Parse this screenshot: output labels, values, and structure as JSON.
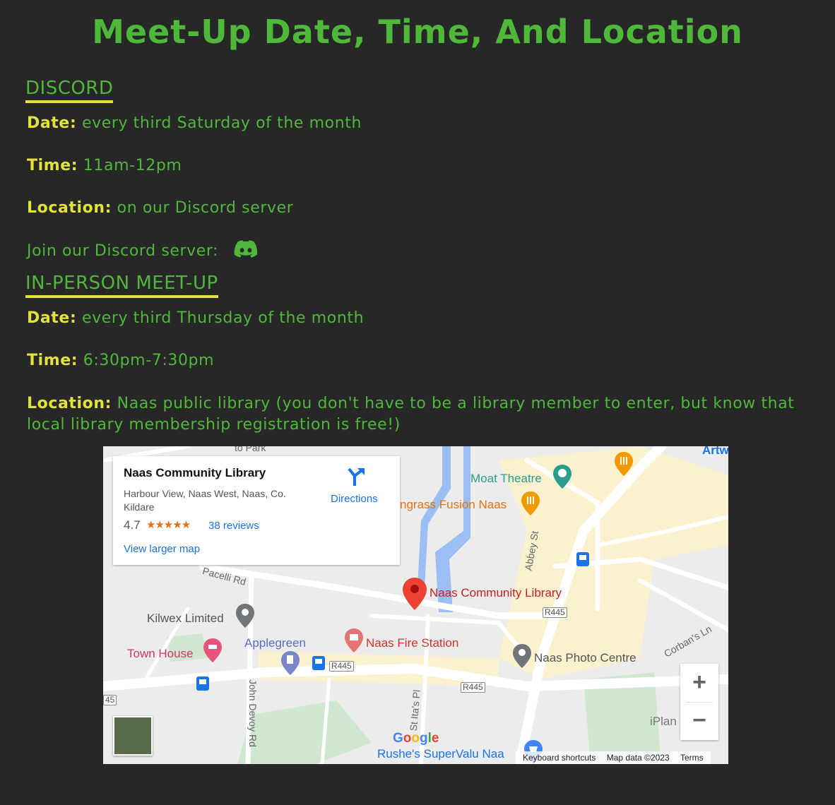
{
  "title": "Meet-Up Date, Time, And Location",
  "discord": {
    "heading": "DISCORD",
    "date_label": "Date:",
    "date_value": "every third Saturday of the month",
    "time_label": "Time:",
    "time_value": "11am-12pm",
    "location_label": "Location:",
    "location_value": "on our Discord server",
    "join_text": "Join our Discord server:",
    "join_icon": "discord-icon"
  },
  "inperson": {
    "heading": "IN-PERSON MEET-UP",
    "date_label": "Date:",
    "date_value": "every third Thursday of the month",
    "time_label": "Time:",
    "time_value": "6:30pm-7:30pm",
    "location_label": "Location:",
    "location_value": "Naas public library (you don't have to be a library member to enter, but know that local library membership registration is free!)"
  },
  "map": {
    "card": {
      "name": "Naas Community Library",
      "address": "Harbour View, Naas West, Naas, Co. Kildare",
      "rating": "4.7",
      "stars": "★★★★★",
      "reviews": "38 reviews",
      "larger_map": "View larger map",
      "directions": "Directions"
    },
    "places": {
      "moat_theatre": "Moat Theatre",
      "lemongrass": "ngrass Fusion Naas",
      "library": "Naas Community Library",
      "kilwex": "Kilwex Limited",
      "town_house": "Town House",
      "applegreen": "Applegreen",
      "fire_station": "Naas Fire Station",
      "photo_centre": "Naas Photo Centre",
      "supervalu": "Rushe's SuperValu Naa",
      "iplan": "iPlan",
      "artw": "Artw",
      "park": "to Park"
    },
    "roads": {
      "r445_a": "R445",
      "r445_b": "R445",
      "r445_c": "R445",
      "r445_d": "45",
      "pacelli": "Pacelli Rd",
      "abbey": "Abbey St",
      "st_itas": "St Ita's Pl",
      "john_devoy": "John Devoy Rd",
      "corbans": "Corban's Ln"
    },
    "zoom_in": "+",
    "zoom_out": "−",
    "google": "Google",
    "attribution": {
      "shortcuts": "Keyboard shortcuts",
      "data": "Map data ©2023",
      "terms": "Terms"
    },
    "colors": {
      "red_pin": "#d93025",
      "teal": "#2a9d8f",
      "orange": "#e8710a",
      "pink": "#d6336c",
      "blue": "#1a73e8",
      "water": "#9bbff4"
    }
  }
}
